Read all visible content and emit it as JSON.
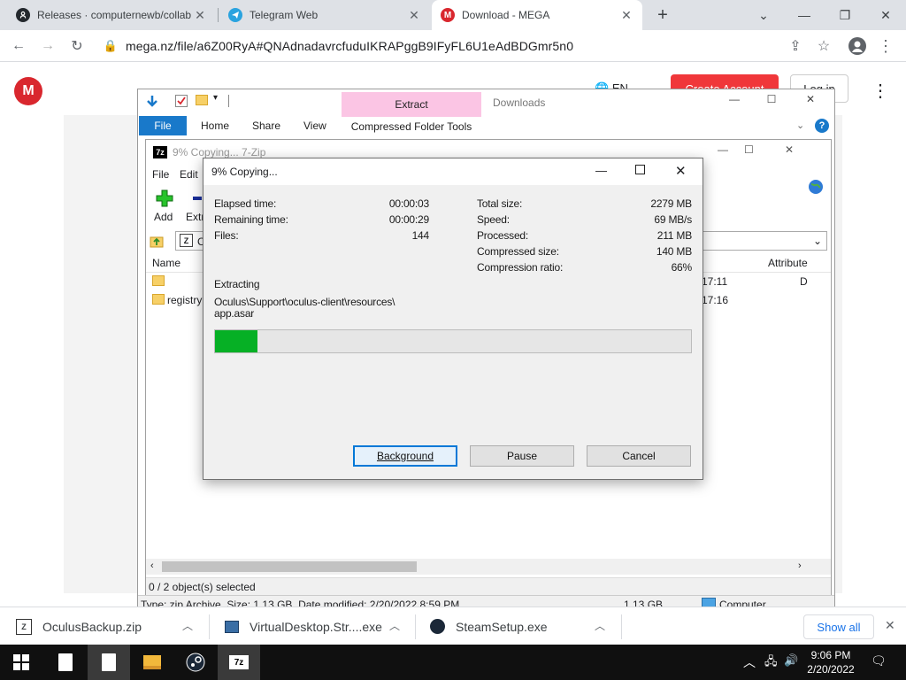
{
  "browser": {
    "tabs": [
      {
        "title": "Releases · computernewb/collab",
        "active": false
      },
      {
        "title": "Telegram Web",
        "active": false
      },
      {
        "title": "Download - MEGA",
        "active": true
      }
    ],
    "new_tab_symbol": "+",
    "url": "mega.nz/file/a6Z00RyA#QNAdnadavrcfuduIKRAPggB9IFyFL6U1eAdBDGmr5n0"
  },
  "mega": {
    "logo_letter": "M",
    "create_account": "Create Account",
    "login": "Log in",
    "lang": "EN"
  },
  "explorer": {
    "title": "Downloads",
    "extract_label": "Extract",
    "file_tab": "File",
    "tabs": [
      "Home",
      "Share",
      "View"
    ],
    "compressed_tools": "Compressed Folder Tools",
    "status": "Type: zip Archive, Size: 1.13 GB, Date modified: 2/20/2022 8:59 PM",
    "status_size": "1.13 GB",
    "status_location": "Computer"
  },
  "zip": {
    "title": "9% Copying... 7-Zip",
    "menus": [
      "File",
      "Edit"
    ],
    "tools": [
      "Add",
      "Extr"
    ],
    "path_prefix": "C",
    "column_name": "Name",
    "column_attr": "Attribute",
    "rows": [
      {
        "name": "",
        "time": "17:11",
        "attr": "D"
      },
      {
        "name": "registry",
        "time": "17:16",
        "attr": ""
      }
    ],
    "status": "0 / 2 object(s) selected"
  },
  "dialog": {
    "title": "9% Copying...",
    "left_stats": [
      {
        "label": "Elapsed time:",
        "value": "00:00:03"
      },
      {
        "label": "Remaining time:",
        "value": "00:00:29"
      },
      {
        "label": "Files:",
        "value": "144"
      }
    ],
    "right_stats": [
      {
        "label": "Total size:",
        "value": "2279 MB"
      },
      {
        "label": "Speed:",
        "value": "69 MB/s"
      },
      {
        "label": "Processed:",
        "value": "211 MB"
      },
      {
        "label": "Compressed size:",
        "value": "140 MB"
      },
      {
        "label": "Compression ratio:",
        "value": "66%"
      }
    ],
    "action": "Extracting",
    "path_line1": "Oculus\\Support\\oculus-client\\resources\\",
    "path_line2": "app.asar",
    "progress_percent": 9,
    "buttons": {
      "background": "Background",
      "pause": "Pause",
      "cancel": "Cancel"
    }
  },
  "downloads": {
    "items": [
      "OculusBackup.zip",
      "VirtualDesktop.Str....exe",
      "SteamSetup.exe"
    ],
    "show_all": "Show all"
  },
  "taskbar": {
    "time": "9:06 PM",
    "date": "2/20/2022"
  },
  "colors": {
    "progress": "#06b025",
    "mega_red": "#d9272e",
    "file_tab": "#1979ca",
    "extract_tab": "#fbc5e4"
  }
}
